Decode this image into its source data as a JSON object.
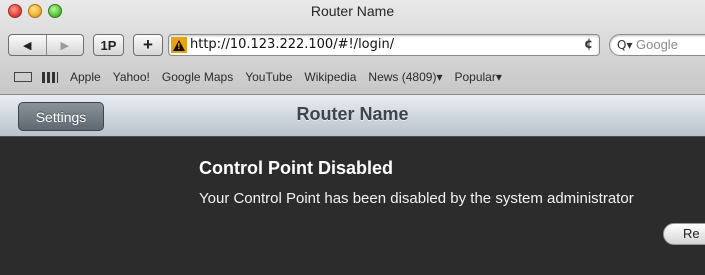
{
  "window": {
    "title": "Router Name"
  },
  "toolbar": {
    "back_glyph": "◀",
    "forward_glyph": "▶",
    "onepassword_label": "1P",
    "add_label": "+",
    "url": "http://10.123.222.100/#!/login/",
    "reload_glyph": "¢",
    "search_placeholder": "Google",
    "search_glyph": "Q▾"
  },
  "bookmarks": [
    "Apple",
    "Yahoo!",
    "Google Maps",
    "YouTube",
    "Wikipedia",
    "News (4809)▾",
    "Popular▾"
  ],
  "app_header": {
    "settings_label": "Settings",
    "title": "Router Name"
  },
  "message": {
    "title": "Control Point Disabled",
    "body": "Your Control Point has been disabled by the system administrator",
    "button_label": "Re"
  },
  "icons": {
    "security_warning": "warning-icon",
    "bookmarks_book": "book-icon",
    "top_sites": "grid-icon"
  },
  "colors": {
    "content_bg": "#2c2c2c",
    "warning": "#e9a311"
  }
}
